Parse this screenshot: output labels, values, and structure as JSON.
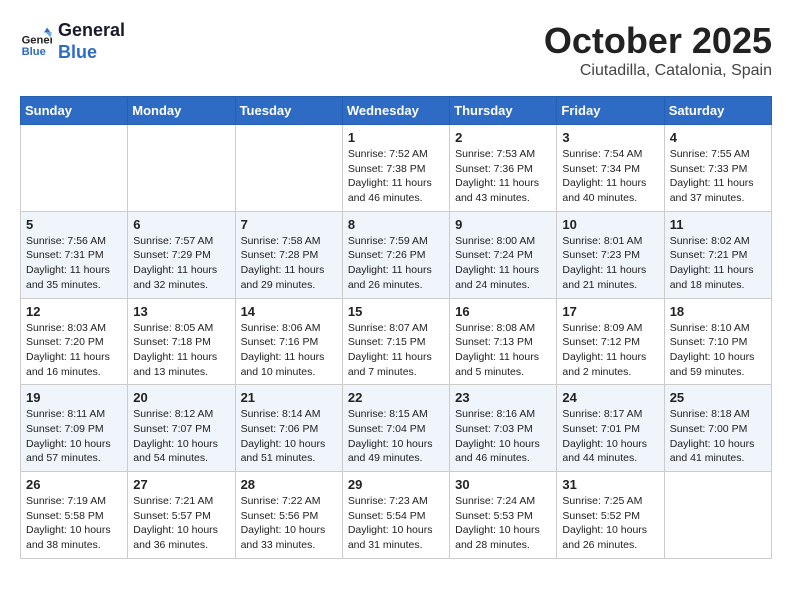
{
  "header": {
    "logo_line1": "General",
    "logo_line2": "Blue",
    "month": "October 2025",
    "location": "Ciutadilla, Catalonia, Spain"
  },
  "weekdays": [
    "Sunday",
    "Monday",
    "Tuesday",
    "Wednesday",
    "Thursday",
    "Friday",
    "Saturday"
  ],
  "weeks": [
    [
      {
        "day": "",
        "info": ""
      },
      {
        "day": "",
        "info": ""
      },
      {
        "day": "",
        "info": ""
      },
      {
        "day": "1",
        "info": "Sunrise: 7:52 AM\nSunset: 7:38 PM\nDaylight: 11 hours and 46 minutes."
      },
      {
        "day": "2",
        "info": "Sunrise: 7:53 AM\nSunset: 7:36 PM\nDaylight: 11 hours and 43 minutes."
      },
      {
        "day": "3",
        "info": "Sunrise: 7:54 AM\nSunset: 7:34 PM\nDaylight: 11 hours and 40 minutes."
      },
      {
        "day": "4",
        "info": "Sunrise: 7:55 AM\nSunset: 7:33 PM\nDaylight: 11 hours and 37 minutes."
      }
    ],
    [
      {
        "day": "5",
        "info": "Sunrise: 7:56 AM\nSunset: 7:31 PM\nDaylight: 11 hours and 35 minutes."
      },
      {
        "day": "6",
        "info": "Sunrise: 7:57 AM\nSunset: 7:29 PM\nDaylight: 11 hours and 32 minutes."
      },
      {
        "day": "7",
        "info": "Sunrise: 7:58 AM\nSunset: 7:28 PM\nDaylight: 11 hours and 29 minutes."
      },
      {
        "day": "8",
        "info": "Sunrise: 7:59 AM\nSunset: 7:26 PM\nDaylight: 11 hours and 26 minutes."
      },
      {
        "day": "9",
        "info": "Sunrise: 8:00 AM\nSunset: 7:24 PM\nDaylight: 11 hours and 24 minutes."
      },
      {
        "day": "10",
        "info": "Sunrise: 8:01 AM\nSunset: 7:23 PM\nDaylight: 11 hours and 21 minutes."
      },
      {
        "day": "11",
        "info": "Sunrise: 8:02 AM\nSunset: 7:21 PM\nDaylight: 11 hours and 18 minutes."
      }
    ],
    [
      {
        "day": "12",
        "info": "Sunrise: 8:03 AM\nSunset: 7:20 PM\nDaylight: 11 hours and 16 minutes."
      },
      {
        "day": "13",
        "info": "Sunrise: 8:05 AM\nSunset: 7:18 PM\nDaylight: 11 hours and 13 minutes."
      },
      {
        "day": "14",
        "info": "Sunrise: 8:06 AM\nSunset: 7:16 PM\nDaylight: 11 hours and 10 minutes."
      },
      {
        "day": "15",
        "info": "Sunrise: 8:07 AM\nSunset: 7:15 PM\nDaylight: 11 hours and 7 minutes."
      },
      {
        "day": "16",
        "info": "Sunrise: 8:08 AM\nSunset: 7:13 PM\nDaylight: 11 hours and 5 minutes."
      },
      {
        "day": "17",
        "info": "Sunrise: 8:09 AM\nSunset: 7:12 PM\nDaylight: 11 hours and 2 minutes."
      },
      {
        "day": "18",
        "info": "Sunrise: 8:10 AM\nSunset: 7:10 PM\nDaylight: 10 hours and 59 minutes."
      }
    ],
    [
      {
        "day": "19",
        "info": "Sunrise: 8:11 AM\nSunset: 7:09 PM\nDaylight: 10 hours and 57 minutes."
      },
      {
        "day": "20",
        "info": "Sunrise: 8:12 AM\nSunset: 7:07 PM\nDaylight: 10 hours and 54 minutes."
      },
      {
        "day": "21",
        "info": "Sunrise: 8:14 AM\nSunset: 7:06 PM\nDaylight: 10 hours and 51 minutes."
      },
      {
        "day": "22",
        "info": "Sunrise: 8:15 AM\nSunset: 7:04 PM\nDaylight: 10 hours and 49 minutes."
      },
      {
        "day": "23",
        "info": "Sunrise: 8:16 AM\nSunset: 7:03 PM\nDaylight: 10 hours and 46 minutes."
      },
      {
        "day": "24",
        "info": "Sunrise: 8:17 AM\nSunset: 7:01 PM\nDaylight: 10 hours and 44 minutes."
      },
      {
        "day": "25",
        "info": "Sunrise: 8:18 AM\nSunset: 7:00 PM\nDaylight: 10 hours and 41 minutes."
      }
    ],
    [
      {
        "day": "26",
        "info": "Sunrise: 7:19 AM\nSunset: 5:58 PM\nDaylight: 10 hours and 38 minutes."
      },
      {
        "day": "27",
        "info": "Sunrise: 7:21 AM\nSunset: 5:57 PM\nDaylight: 10 hours and 36 minutes."
      },
      {
        "day": "28",
        "info": "Sunrise: 7:22 AM\nSunset: 5:56 PM\nDaylight: 10 hours and 33 minutes."
      },
      {
        "day": "29",
        "info": "Sunrise: 7:23 AM\nSunset: 5:54 PM\nDaylight: 10 hours and 31 minutes."
      },
      {
        "day": "30",
        "info": "Sunrise: 7:24 AM\nSunset: 5:53 PM\nDaylight: 10 hours and 28 minutes."
      },
      {
        "day": "31",
        "info": "Sunrise: 7:25 AM\nSunset: 5:52 PM\nDaylight: 10 hours and 26 minutes."
      },
      {
        "day": "",
        "info": ""
      }
    ]
  ]
}
